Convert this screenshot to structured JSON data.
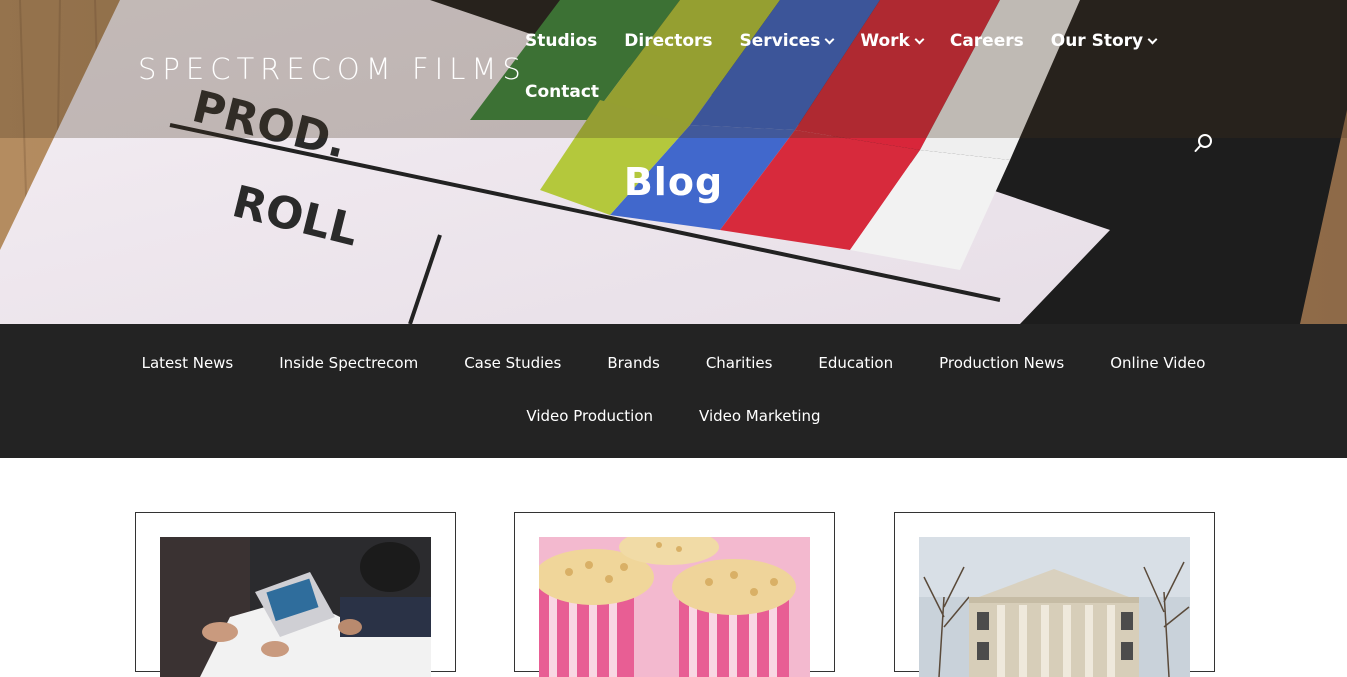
{
  "brand": {
    "logo_text": "SPECTRECOM FILMS"
  },
  "main_nav": {
    "items": [
      {
        "label": "Studios",
        "has_dropdown": false
      },
      {
        "label": "Directors",
        "has_dropdown": false
      },
      {
        "label": "Services",
        "has_dropdown": true
      },
      {
        "label": "Work",
        "has_dropdown": true
      },
      {
        "label": "Careers",
        "has_dropdown": false
      },
      {
        "label": "Our Story",
        "has_dropdown": true
      },
      {
        "label": "Contact",
        "has_dropdown": false
      }
    ],
    "search_icon": "search-icon"
  },
  "hero": {
    "title": "Blog",
    "image": "film-clapperboard",
    "clapper_text": [
      "PROD.",
      "ROLL"
    ]
  },
  "categories": {
    "row1": [
      "Latest News",
      "Inside Spectrecom",
      "Case Studies",
      "Brands",
      "Charities",
      "Education",
      "Production News",
      "Online Video"
    ],
    "row2": [
      "Video Production",
      "Video Marketing"
    ]
  },
  "posts": [
    {
      "thumbnail": "people-with-laptop-meeting"
    },
    {
      "thumbnail": "rice-crispy-cakes-pink-cases"
    },
    {
      "thumbnail": "historic-building-facade"
    }
  ],
  "colors": {
    "category_bar": "#232323",
    "text_on_dark": "#ffffff",
    "card_border": "#333333"
  }
}
